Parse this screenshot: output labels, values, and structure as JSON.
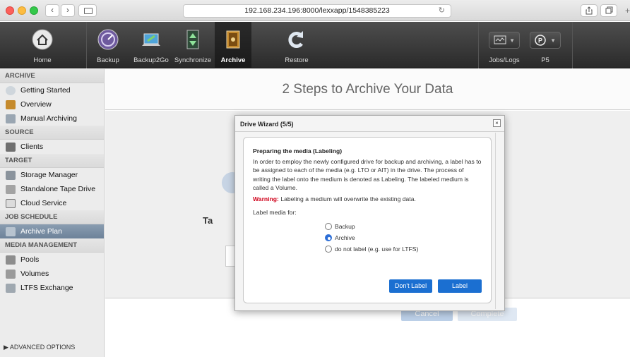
{
  "browser": {
    "url": "192.168.234.196:8000/lexxapp/1548385223",
    "back_glyph": "‹",
    "forward_glyph": "›",
    "reload_glyph": "↻",
    "new_tab_glyph": "+"
  },
  "toolbar": {
    "items": [
      {
        "label": "Home",
        "icon": "home-icon"
      },
      {
        "label": "Backup",
        "icon": "backup-icon"
      },
      {
        "label": "Backup2Go",
        "icon": "laptop-icon"
      },
      {
        "label": "Synchronize",
        "icon": "sync-icon"
      },
      {
        "label": "Archive",
        "icon": "archive-icon",
        "active": true
      },
      {
        "label": "Restore",
        "icon": "restore-icon"
      }
    ],
    "right": [
      {
        "label": "Jobs/Logs",
        "icon": "monitor-icon"
      },
      {
        "label": "P5",
        "icon": "p5-icon"
      }
    ]
  },
  "sidebar": {
    "sections": [
      {
        "title": "ARCHIVE",
        "items": [
          "Getting Started",
          "Overview",
          "Manual Archiving"
        ]
      },
      {
        "title": "SOURCE",
        "items": [
          "Clients"
        ]
      },
      {
        "title": "TARGET",
        "items": [
          "Storage Manager",
          "Standalone Tape Drive",
          "Cloud Service"
        ]
      },
      {
        "title": "JOB SCHEDULE",
        "items": [
          "Archive Plan"
        ]
      },
      {
        "title": "MEDIA MANAGEMENT",
        "items": [
          "Pools",
          "Volumes",
          "LTFS Exchange"
        ]
      }
    ],
    "selected": "Archive Plan",
    "advanced": "▶ ADVANCED OPTIONS"
  },
  "main": {
    "title": "2 Steps to Archive Your Data",
    "partial_heading": "Ta",
    "cancel_label": "Cancel",
    "complete_label": "Complete"
  },
  "dialog": {
    "title": "Drive Wizard (5/5)",
    "close_glyph": "×",
    "heading": "Preparing the media (Labeling)",
    "body": "In order to employ the newly configured drive for backup and archiving, a label has to be assigned to each of the media (e.g. LTO or AIT) in the drive. The process of writing the label onto the medium is denoted as Labeling. The labeled medium is called a Volume.",
    "warning_label": "Warning:",
    "warning_text": "Labeling a medium will overwrite the existing data.",
    "label_media_for": "Label media for:",
    "options": [
      "Backup",
      "Archive",
      "do not label (e.g. use for LTFS)"
    ],
    "selected_option": "Archive",
    "dont_label_button": "Don't Label",
    "label_button": "Label"
  },
  "colors": {
    "accent": "#1b6fd1",
    "warning": "#d0021b",
    "sidebar_selected": "#7b8fa5"
  }
}
